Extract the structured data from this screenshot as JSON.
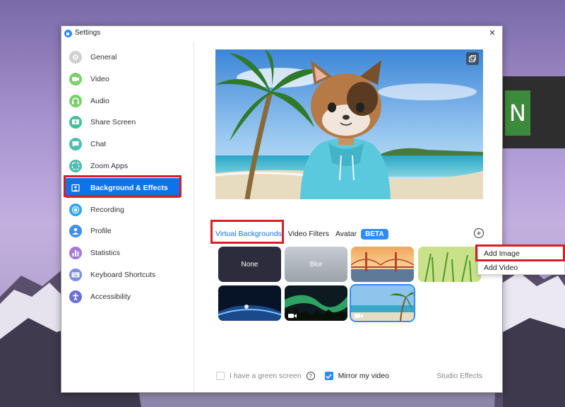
{
  "window": {
    "title": "Settings",
    "close_symbol": "×"
  },
  "sidebar": {
    "items": [
      {
        "label": "General",
        "icon": "gear-icon",
        "color": "#d0d0d0"
      },
      {
        "label": "Video",
        "icon": "video-camera-icon",
        "color": "#7ccf6e"
      },
      {
        "label": "Audio",
        "icon": "headphones-icon",
        "color": "#7ccf6e"
      },
      {
        "label": "Share Screen",
        "icon": "share-screen-icon",
        "color": "#45c19a"
      },
      {
        "label": "Chat",
        "icon": "chat-bubble-icon",
        "color": "#4dbeb0"
      },
      {
        "label": "Zoom Apps",
        "icon": "apps-icon",
        "color": "#4dbeb0"
      },
      {
        "label": "Background & Effects",
        "icon": "portrait-icon",
        "color": "#0e72ed"
      },
      {
        "label": "Recording",
        "icon": "record-icon",
        "color": "#35a4e8"
      },
      {
        "label": "Profile",
        "icon": "person-icon",
        "color": "#3f8fe8"
      },
      {
        "label": "Statistics",
        "icon": "bar-chart-icon",
        "color": "#a57ad6"
      },
      {
        "label": "Keyboard Shortcuts",
        "icon": "keyboard-icon",
        "color": "#7f8de0"
      },
      {
        "label": "Accessibility",
        "icon": "accessibility-icon",
        "color": "#6b6fd6"
      }
    ],
    "active_index": 6
  },
  "tabs": {
    "virtual_backgrounds": "Virtual Backgrounds",
    "video_filters": "Video Filters",
    "avatar": "Avatar",
    "beta": "BETA"
  },
  "thumbnails": [
    {
      "label": "None",
      "kind": "none"
    },
    {
      "label": "Blur",
      "kind": "blur"
    },
    {
      "label": "",
      "kind": "golden-gate-bridge"
    },
    {
      "label": "",
      "kind": "grass"
    },
    {
      "label": "",
      "kind": "earth-from-space"
    },
    {
      "label": "",
      "kind": "aurora",
      "video": true
    },
    {
      "label": "",
      "kind": "beach",
      "video": true,
      "selected": true
    }
  ],
  "footer": {
    "green_screen_label": "I have a green screen",
    "green_screen_checked": false,
    "mirror_label": "Mirror my video",
    "mirror_checked": true,
    "studio_effects": "Studio Effects"
  },
  "context_menu": {
    "add_image": "Add Image",
    "add_video": "Add Video"
  },
  "colors": {
    "accent": "#0e72ed",
    "highlight_red": "#d61f26"
  }
}
